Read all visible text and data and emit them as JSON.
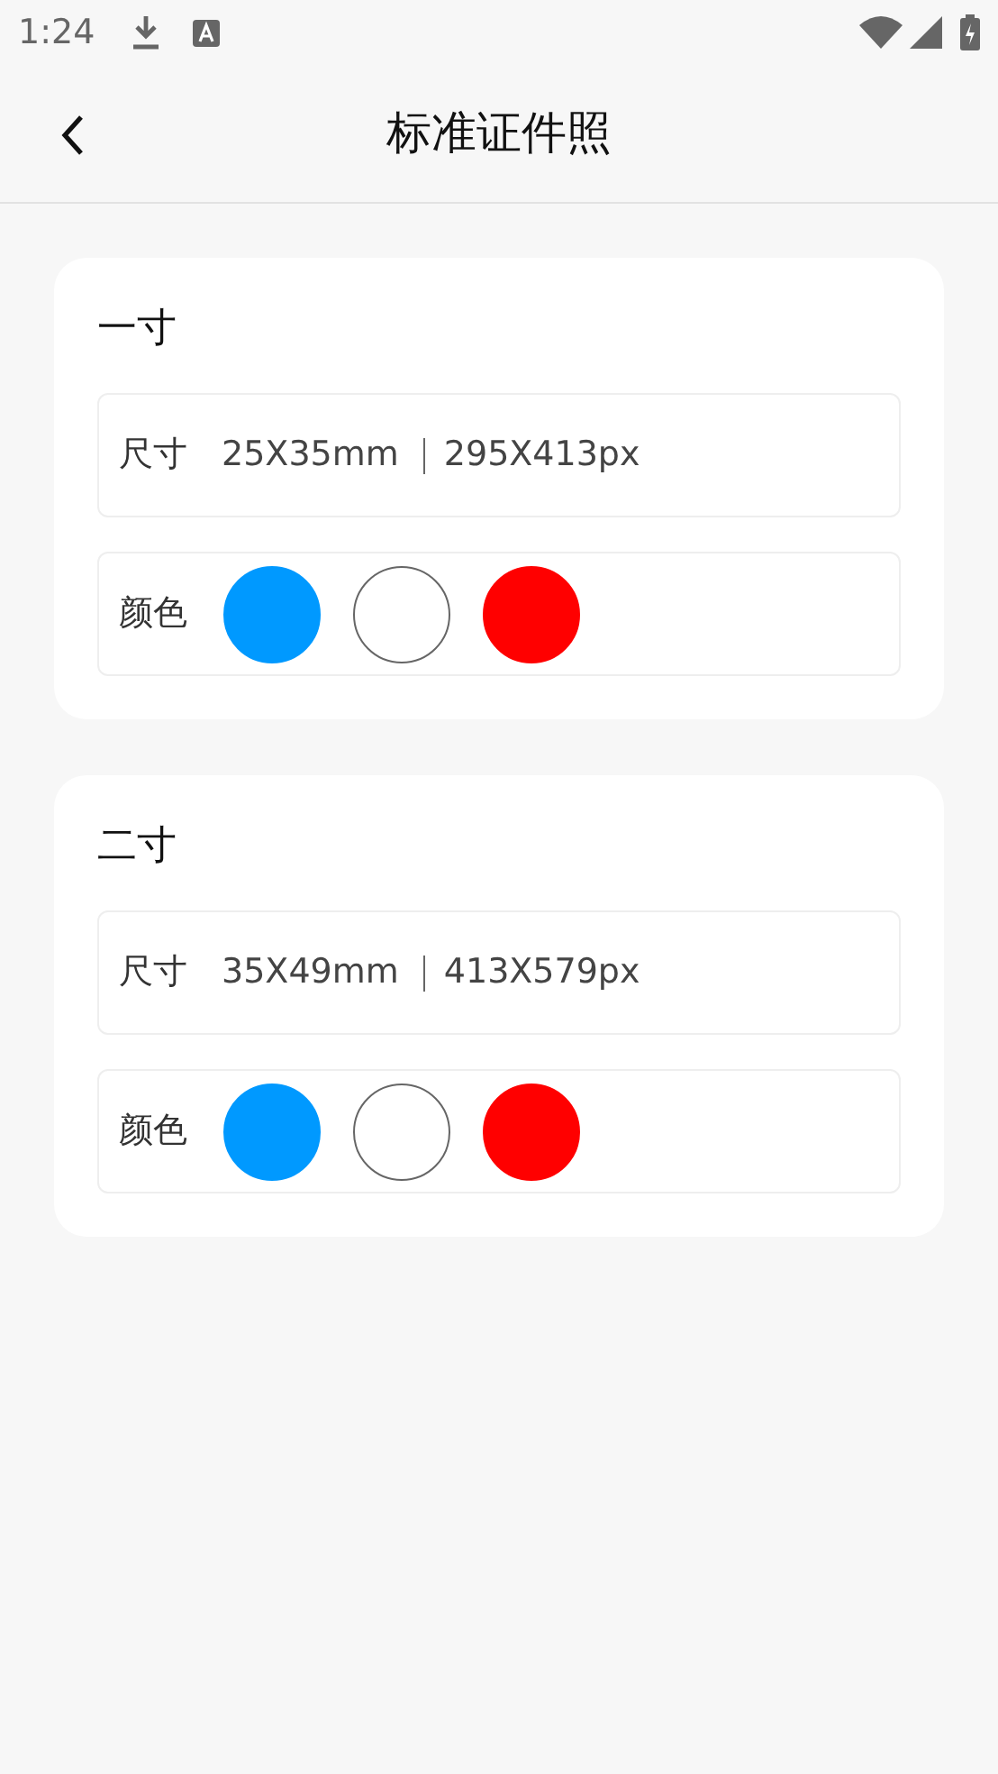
{
  "status_bar": {
    "time": "1:24"
  },
  "header": {
    "title": "标准证件照"
  },
  "cards": [
    {
      "title": "一寸",
      "size_label": "尺寸",
      "size_mm": "25X35mm",
      "size_px": "295X413px",
      "color_label": "颜色",
      "colors": [
        {
          "color": "#0099ff"
        },
        {
          "color": "#ffffff"
        },
        {
          "color": "#ff0000"
        }
      ]
    },
    {
      "title": "二寸",
      "size_label": "尺寸",
      "size_mm": "35X49mm",
      "size_px": "413X579px",
      "color_label": "颜色",
      "colors": [
        {
          "color": "#0099ff"
        },
        {
          "color": "#ffffff"
        },
        {
          "color": "#ff0000"
        }
      ]
    }
  ]
}
